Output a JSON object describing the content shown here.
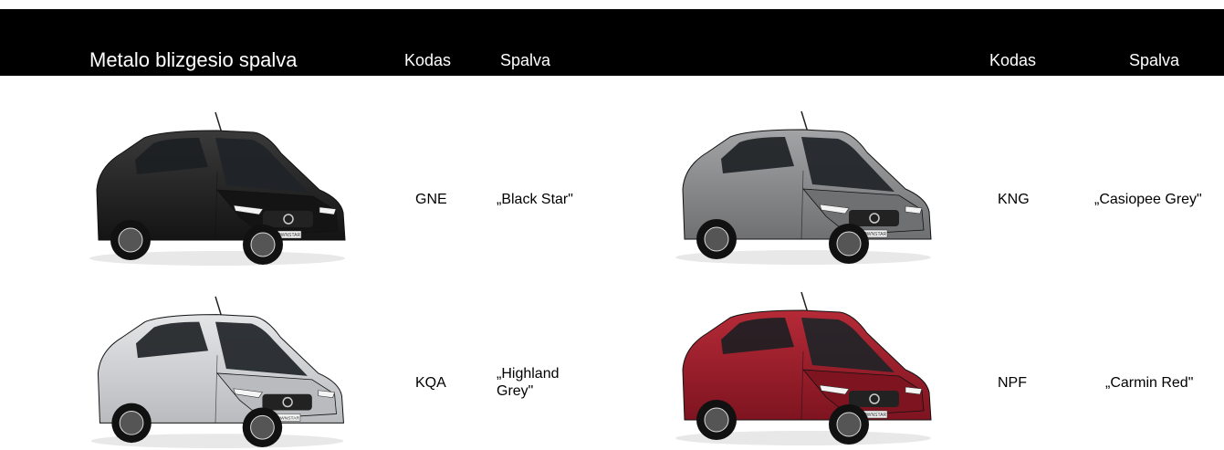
{
  "header": {
    "title": "Metalo blizgesio spalva",
    "col_code_left": "Kodas",
    "col_color_left": "Spalva",
    "col_code_right": "Kodas",
    "col_color_right": "Spalva"
  },
  "rows": [
    {
      "code": "GNE",
      "color": "„Black Star\"",
      "paint": "#141414",
      "paint_light": "#3a3a3a"
    },
    {
      "code": "KNG",
      "color": "„Casiopee Grey\"",
      "paint": "#6f7072",
      "paint_light": "#a3a4a6"
    },
    {
      "code": "KQA",
      "color_line1": "„Highland",
      "color_line2": "Grey\"",
      "paint": "#b9bbbe",
      "paint_light": "#e4e5e7"
    },
    {
      "code": "NPF",
      "color": "„Carmin Red\"",
      "paint": "#7e1420",
      "paint_light": "#b52a37"
    }
  ],
  "badge_text": "TOWNSTAR"
}
